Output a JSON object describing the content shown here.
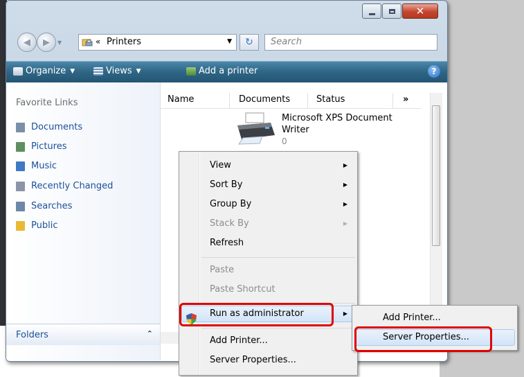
{
  "window": {
    "address": "Printers",
    "address_prefix": "«",
    "search_placeholder": "Search"
  },
  "toolbar": {
    "organize": "Organize",
    "views": "Views",
    "add_printer": "Add a printer",
    "help": "?"
  },
  "sidebar": {
    "title": "Favorite Links",
    "items": [
      {
        "label": "Documents",
        "icon": "documents-icon",
        "color": "#7a8fa8"
      },
      {
        "label": "Pictures",
        "icon": "pictures-icon",
        "color": "#5d8f62"
      },
      {
        "label": "Music",
        "icon": "music-icon",
        "color": "#3f79c4"
      },
      {
        "label": "Recently Changed",
        "icon": "recent-icon",
        "color": "#8c95a8"
      },
      {
        "label": "Searches",
        "icon": "searches-icon",
        "color": "#6d87a8"
      },
      {
        "label": "Public",
        "icon": "public-folder-icon",
        "color": "#e8b935"
      }
    ],
    "folders_label": "Folders"
  },
  "columns": {
    "name": "Name",
    "documents": "Documents",
    "status": "Status",
    "more": "»"
  },
  "printer": {
    "name_line1": "Microsoft XPS Document",
    "name_line2": "Writer",
    "count": "0"
  },
  "context_menu": {
    "view": "View",
    "sort_by": "Sort By",
    "group_by": "Group By",
    "stack_by": "Stack By",
    "refresh": "Refresh",
    "paste": "Paste",
    "paste_shortcut": "Paste Shortcut",
    "run_as_admin": "Run as administrator",
    "add_printer": "Add Printer...",
    "server_properties": "Server Properties..."
  },
  "submenu": {
    "add_printer": "Add Printer...",
    "server_properties": "Server Properties..."
  },
  "colors": {
    "highlight_box": "#e00000",
    "toolbar": "#2f6585",
    "link": "#1c4f99"
  }
}
